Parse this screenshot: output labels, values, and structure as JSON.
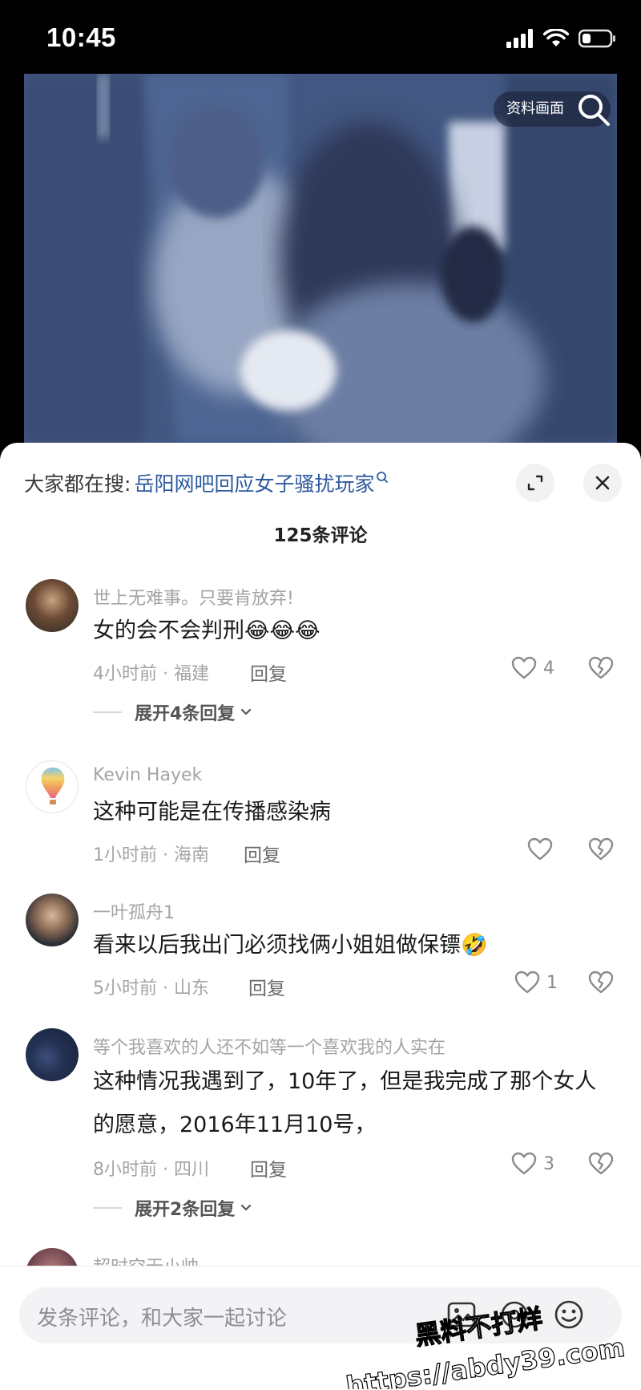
{
  "status_bar": {
    "time": "10:45"
  },
  "video": {
    "search_chip_label": "资料画面"
  },
  "sheet": {
    "search_prefix": "大家都在搜:",
    "search_link": "岳阳网吧回应女子骚扰玩家",
    "comment_count": "125条评论"
  },
  "comments": [
    {
      "user": "世上无难事。只要肯放弃!",
      "text": "女的会不会判刑",
      "emoji": "😂😂😂",
      "time_loc": "4小时前 · 福建",
      "reply": "回复",
      "likes": "4",
      "expand": "展开4条回复"
    },
    {
      "user": "Kevin Hayek",
      "text": "这种可能是在传播感染病",
      "time_loc": "1小时前 · 海南",
      "reply": "回复",
      "likes": ""
    },
    {
      "user": "一叶孤舟1",
      "text": "看来以后我出门必须找俩小姐姐做保镖",
      "emoji": "🤣",
      "time_loc": "5小时前 · 山东",
      "reply": "回复",
      "likes": "1"
    },
    {
      "user": "等个我喜欢的人还不如等一个喜欢我的人实在",
      "text": "这种情况我遇到了，10年了，但是我完成了那个女人的愿意，2016年11月10号，",
      "time_loc": "8小时前 · 四川",
      "reply": "回复",
      "likes": "3",
      "expand": "展开2条回复"
    },
    {
      "user": "超时空无小帅"
    }
  ],
  "input_bar": {
    "placeholder": "发条评论，和大家一起讨论"
  },
  "watermark": {
    "line1": "黑料不打烊",
    "line2": "https://abdy39.com"
  },
  "colors": {
    "link": "#2d5a9e",
    "meta": "#a4a4a8",
    "sheet": "#ffffff",
    "video": "#445a82"
  }
}
